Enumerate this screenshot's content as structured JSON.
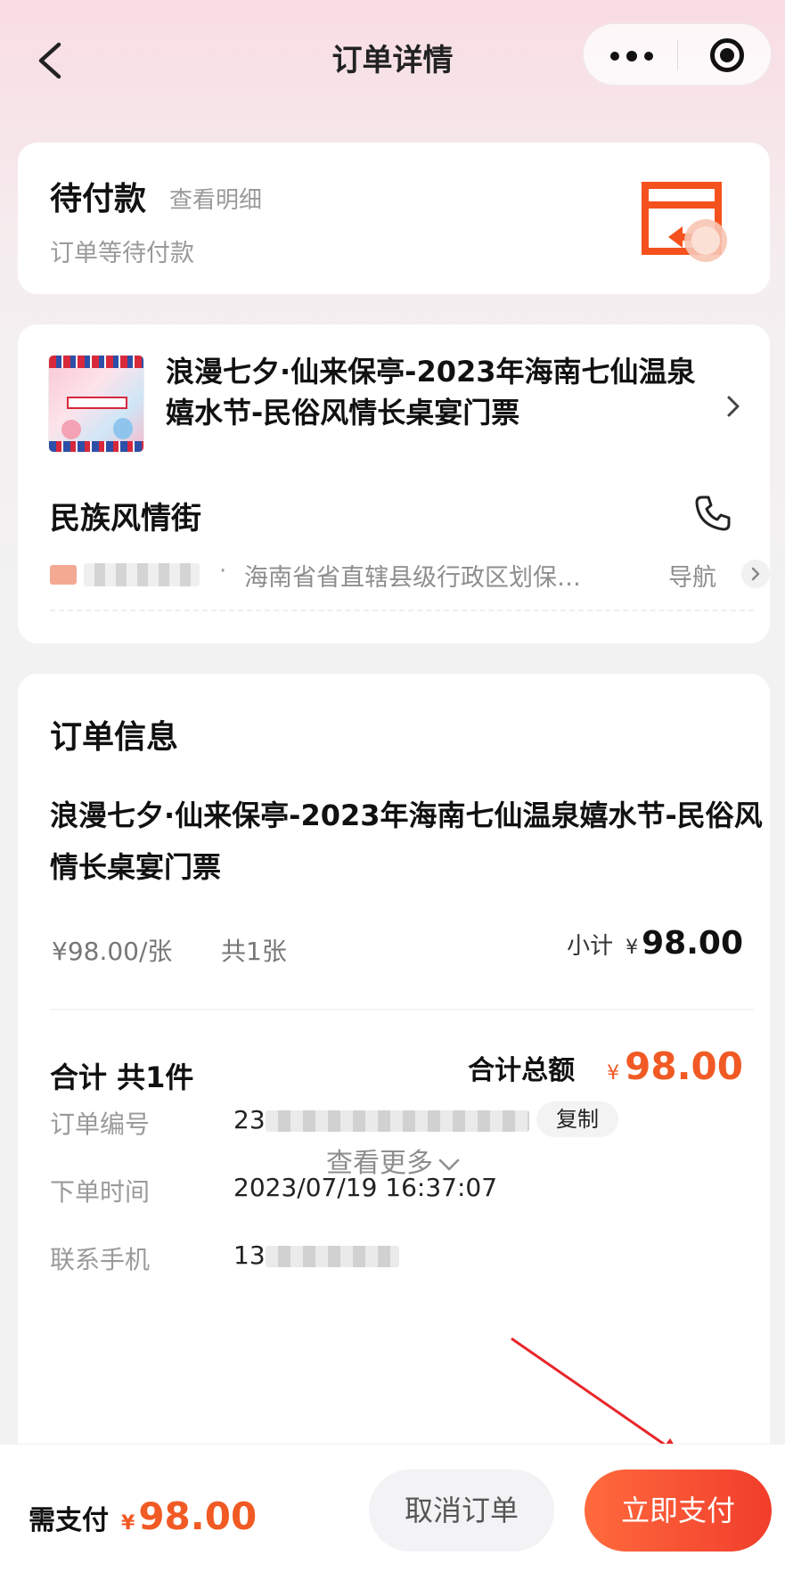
{
  "nav": {
    "title": "订单详情",
    "back_icon": "chevron-left-icon",
    "more_icon": "more-dots-icon",
    "close_icon": "target-close-icon"
  },
  "status": {
    "title": "待付款",
    "detail_link": "查看明细",
    "subtitle": "订单等待付款",
    "icon": "pending-payment-icon",
    "icon_color": "#f4511e"
  },
  "product": {
    "name": "浪漫七夕·仙来保亭-2023年海南七仙温泉嬉水节-民俗风情长桌宴门票",
    "venue": "民族风情街",
    "address": "海南省省直辖县级行政区划保亭…",
    "separator": "·",
    "navigate_label": "导航"
  },
  "order": {
    "section_title": "订单信息",
    "product_name": "浪漫七夕·仙来保亭-2023年海南七仙温泉嬉水节-民俗风情长桌宴门票",
    "unit_price": "¥98.00/张",
    "quantity": "共1张",
    "subtotal_label": "小计",
    "currency": "¥",
    "subtotal_value": "98.00",
    "total_count": "合计 共1件",
    "total_label": "合计总额",
    "total_value": "98.00",
    "see_more": "查看更多",
    "rows": {
      "order_no_label": "订单编号",
      "order_no_prefix": "23",
      "copy_label": "复制",
      "time_label": "下单时间",
      "time_value": "2023/07/19 16:37:07",
      "phone_label": "联系手机",
      "phone_prefix": "13"
    }
  },
  "footer": {
    "need_pay_label": "需支付",
    "currency": "¥",
    "amount": "98.00",
    "cancel_label": "取消订单",
    "pay_label": "立即支付",
    "accent_color": "#f15a24"
  }
}
